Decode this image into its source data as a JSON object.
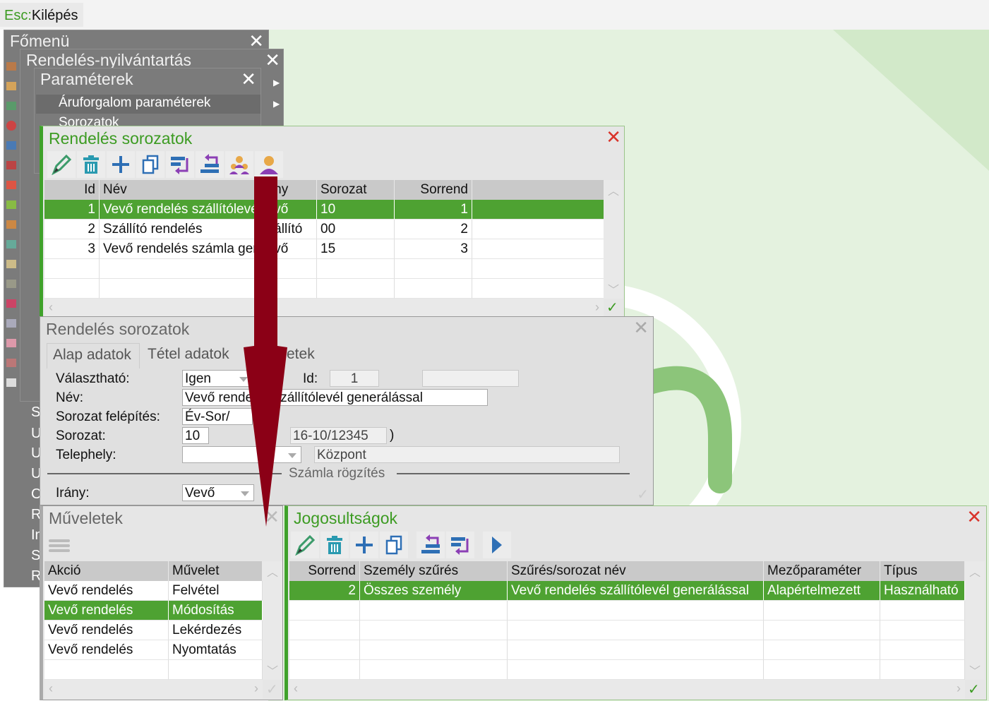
{
  "topbar": {
    "esc_key": "Esc:",
    "esc_label": "Kilépés"
  },
  "menus": {
    "main": {
      "title": "Főmenü",
      "items": [
        "Sz",
        "Ul",
        "Ul",
        "Ul",
        "C",
        "Ru",
        "In",
        "St",
        "Re"
      ]
    },
    "orders": {
      "title": "Rendelés-nyilvántartás"
    },
    "params": {
      "title": "Paraméterek",
      "items": [
        "Áruforgalom paraméterek",
        "Sorozatok"
      ]
    }
  },
  "series_window": {
    "title": "Rendelés sorozatok",
    "toolbar": [
      "edit",
      "delete",
      "add",
      "copy",
      "move-down",
      "move-up",
      "group-users",
      "single-user"
    ],
    "columns": [
      "Id",
      "Név",
      "Irány",
      "Sorozat",
      "Sorrend"
    ],
    "rows": [
      {
        "id": "1",
        "name": "Vevő rendelés szállítólevél generálással",
        "direction": "Vevő",
        "series": "10",
        "order": "1",
        "selected": true
      },
      {
        "id": "2",
        "name": "Szállító rendelés",
        "direction": "Szállító",
        "series": "00",
        "order": "2"
      },
      {
        "id": "3",
        "name": "Vevő rendelés számla generálással",
        "direction": "Vevő",
        "series": "15",
        "order": "3"
      }
    ]
  },
  "detail_window": {
    "title": "Rendelés sorozatok",
    "tabs": [
      "Alap adatok",
      "Tétel adatok",
      "etek"
    ],
    "fields": {
      "selectable_label": "Választható:",
      "selectable_value": "Igen",
      "id_label": "Id:",
      "id_value": "1",
      "name_label": "Név:",
      "name_value": "Vevő rendelés szállítólevél generálással",
      "structure_label": "Sorozat felépítés:",
      "structure_value": "Év-Sor/",
      "series_label": "Sorozat:",
      "series_value": "10",
      "example_value": "16-10/12345",
      "example_close": ")",
      "site_label": "Telephely:",
      "site_value": "",
      "site_name": "Központ",
      "section_title": "Számla rögzítés",
      "direction_label": "Irány:",
      "direction_value": "Vevő"
    }
  },
  "operations_window": {
    "title": "Műveletek",
    "columns": [
      "Akció",
      "Művelet"
    ],
    "rows": [
      {
        "action": "Vevő rendelés",
        "operation": "Felvétel"
      },
      {
        "action": "Vevő rendelés",
        "operation": "Módosítás",
        "selected": true
      },
      {
        "action": "Vevő rendelés",
        "operation": "Lekérdezés"
      },
      {
        "action": "Vevő rendelés",
        "operation": "Nyomtatás"
      }
    ]
  },
  "permissions_window": {
    "title": "Jogosultságok",
    "toolbar": [
      "edit",
      "delete",
      "add",
      "copy",
      "move-up",
      "move-down",
      "next"
    ],
    "columns": [
      "Sorrend",
      "Személy szűrés",
      "Szűrés/sorozat név",
      "Mezőparaméter",
      "Típus"
    ],
    "rows": [
      {
        "order": "2",
        "person_filter": "Összes személy",
        "filter_name": "Vevő rendelés szállítólevél generálással",
        "field_param": "Alapértelmezett",
        "type": "Használható",
        "selected": true
      }
    ]
  },
  "colors": {
    "accent": "#3c9b22",
    "selected_row": "#4ea232",
    "arrow": "#8b0016",
    "close_red": "#d9342b"
  }
}
